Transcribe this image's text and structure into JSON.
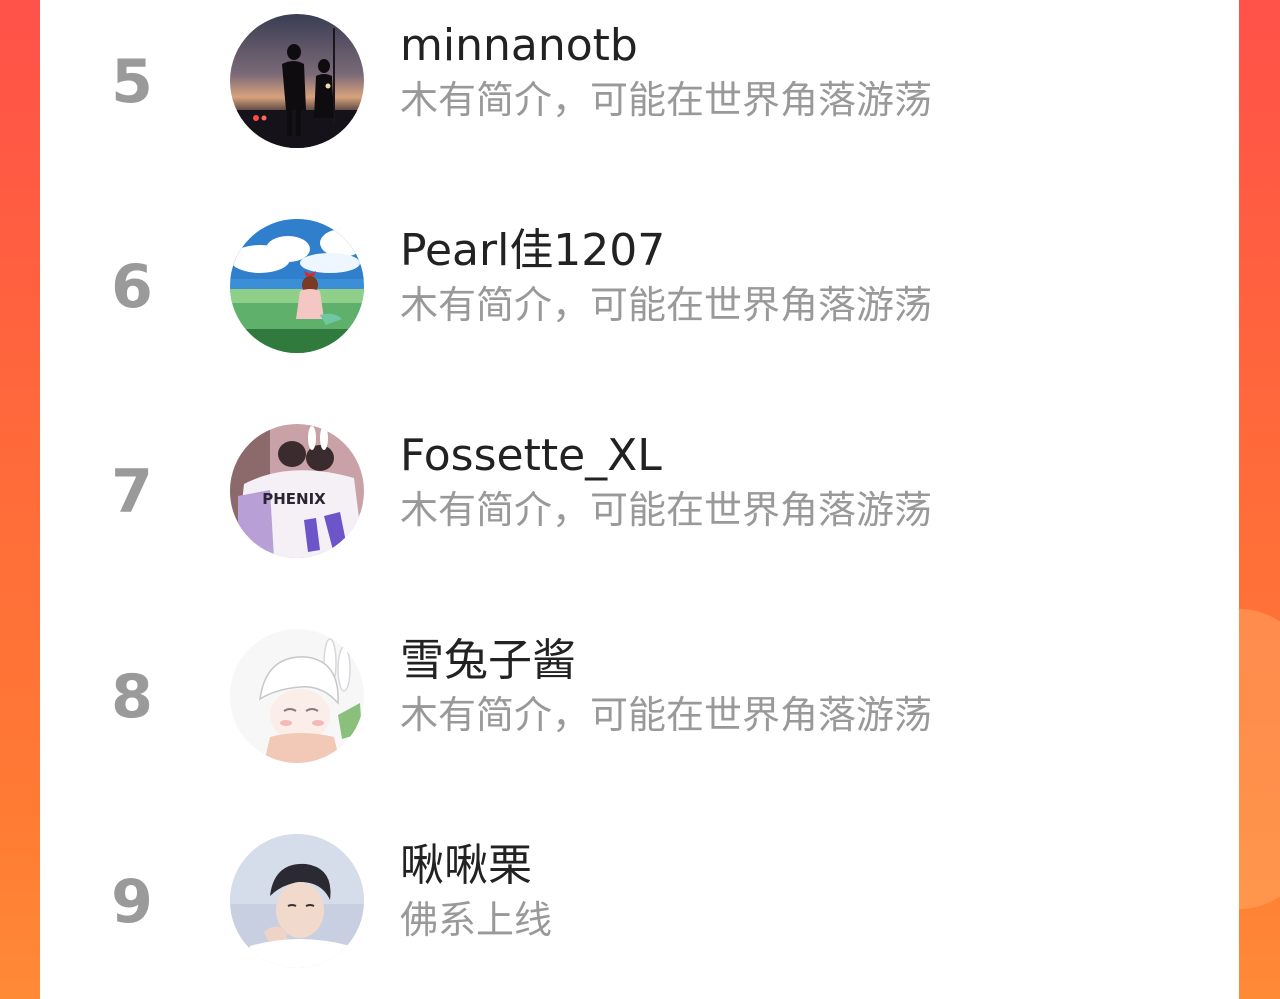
{
  "ranking": {
    "items": [
      {
        "rank": "5",
        "name": "minnanotb",
        "bio": "木有简介，可能在世界角落游荡",
        "avatar": "dusk-couple-photo-avatar"
      },
      {
        "rank": "6",
        "name": "Pearl佳1207",
        "bio": "木有简介，可能在世界角落游荡",
        "avatar": "anime-girl-meadow-sky-avatar"
      },
      {
        "rank": "7",
        "name": "Fossette_XL",
        "bio": "木有简介，可能在世界角落游荡",
        "avatar": "phenix-jacket-couple-avatar",
        "avatar_text": "PHENIX"
      },
      {
        "rank": "8",
        "name": "雪兔子酱",
        "bio": "木有简介，可能在世界角落游荡",
        "avatar": "white-haired-anime-boy-avatar"
      },
      {
        "rank": "9",
        "name": "啾啾栗",
        "bio": "佛系上线",
        "avatar": "young-man-portrait-avatar"
      }
    ]
  },
  "colors": {
    "background_gradient_top": "#ff5149",
    "background_gradient_bottom": "#ff8a36",
    "rank_color": "#9a9a9a",
    "name_color": "#222222",
    "bio_color": "#999999"
  }
}
